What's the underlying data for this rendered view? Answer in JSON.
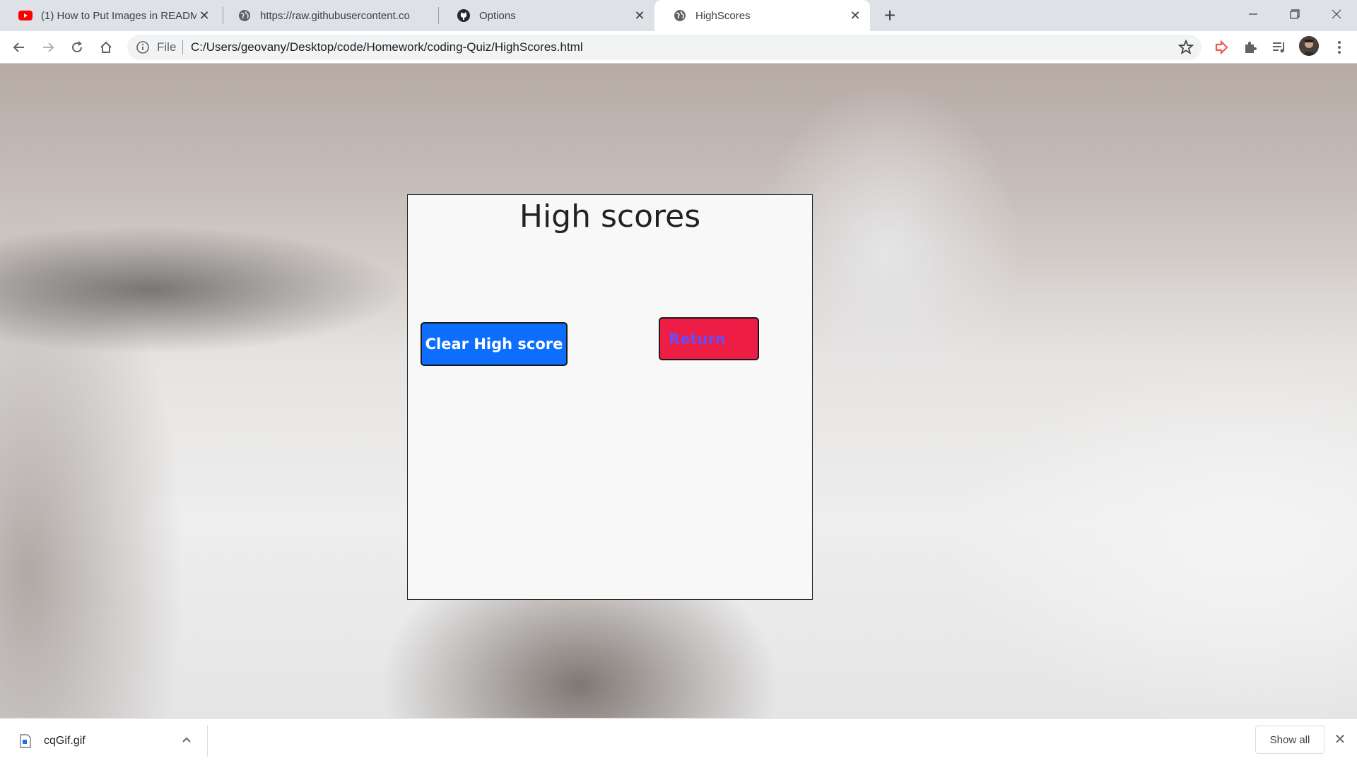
{
  "browser": {
    "tabs": [
      {
        "title": "(1) How to Put Images in READM",
        "icon": "youtube-icon"
      },
      {
        "title": "https://raw.githubusercontent.co",
        "icon": "globe-icon"
      },
      {
        "title": "Options",
        "icon": "github-icon"
      },
      {
        "title": "HighScores",
        "icon": "globe-icon",
        "active": true
      }
    ],
    "address": {
      "scheme_label": "File",
      "url": "C:/Users/geovany/Desktop/code/Homework/coding-Quiz/HighScores.html"
    }
  },
  "page": {
    "heading": "High scores",
    "clear_button_label": "Clear High score",
    "return_button_label": "Return",
    "colors": {
      "clear_button": "#0d6efd",
      "return_button": "#ed1d45",
      "return_text": "#6a4cf5"
    }
  },
  "downloads": {
    "items": [
      {
        "filename": "cqGif.gif"
      }
    ],
    "show_all_label": "Show all"
  }
}
